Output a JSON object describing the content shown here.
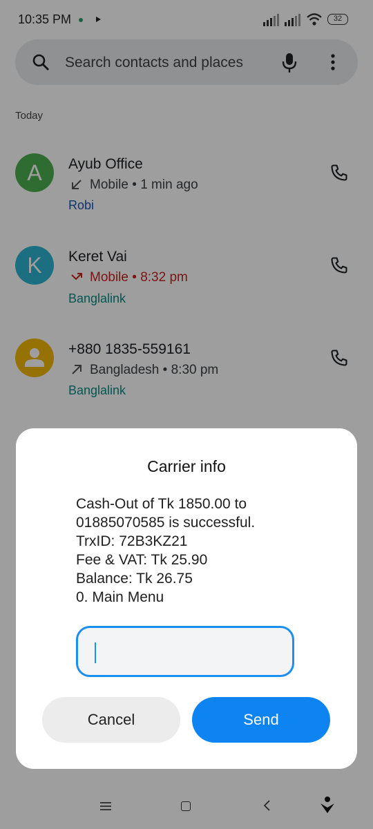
{
  "status_bar": {
    "time": "10:35 PM",
    "battery": "32"
  },
  "search": {
    "placeholder": "Search contacts and places"
  },
  "section_label": "Today",
  "calls": [
    {
      "initial": "A",
      "name": "Ayub Office",
      "type": "Mobile",
      "when": "1 min ago",
      "carrier": "Robi",
      "carrier_color": "#1a55b5",
      "avatar_color": "#4caf50",
      "direction_icon": "incoming-arrow-icon"
    },
    {
      "initial": "K",
      "name": "Keret Vai",
      "type": "Mobile",
      "when": "8:32 pm",
      "carrier": "Banglalink",
      "carrier_color": "#0b8a84",
      "avatar_color": "#2db3cf",
      "direction_icon": "missed-call-icon"
    },
    {
      "initial": "",
      "name": "+880 1835-559161",
      "type": "Bangladesh",
      "when": "8:30 pm",
      "carrier": "Banglalink",
      "carrier_color": "#0b8a84",
      "avatar_color": "#f2b705",
      "direction_icon": "outgoing-arrow-icon"
    }
  ],
  "dialog": {
    "title": "Carrier info",
    "lines": [
      "Cash-Out of Tk 1850.00 to",
      "01885070585 is successful.",
      "TrxID: 72B3KZ21",
      "Fee & VAT: Tk 25.90",
      "Balance: Tk 26.75",
      "0. Main Menu"
    ],
    "input_value": "",
    "cancel_label": "Cancel",
    "send_label": "Send"
  }
}
